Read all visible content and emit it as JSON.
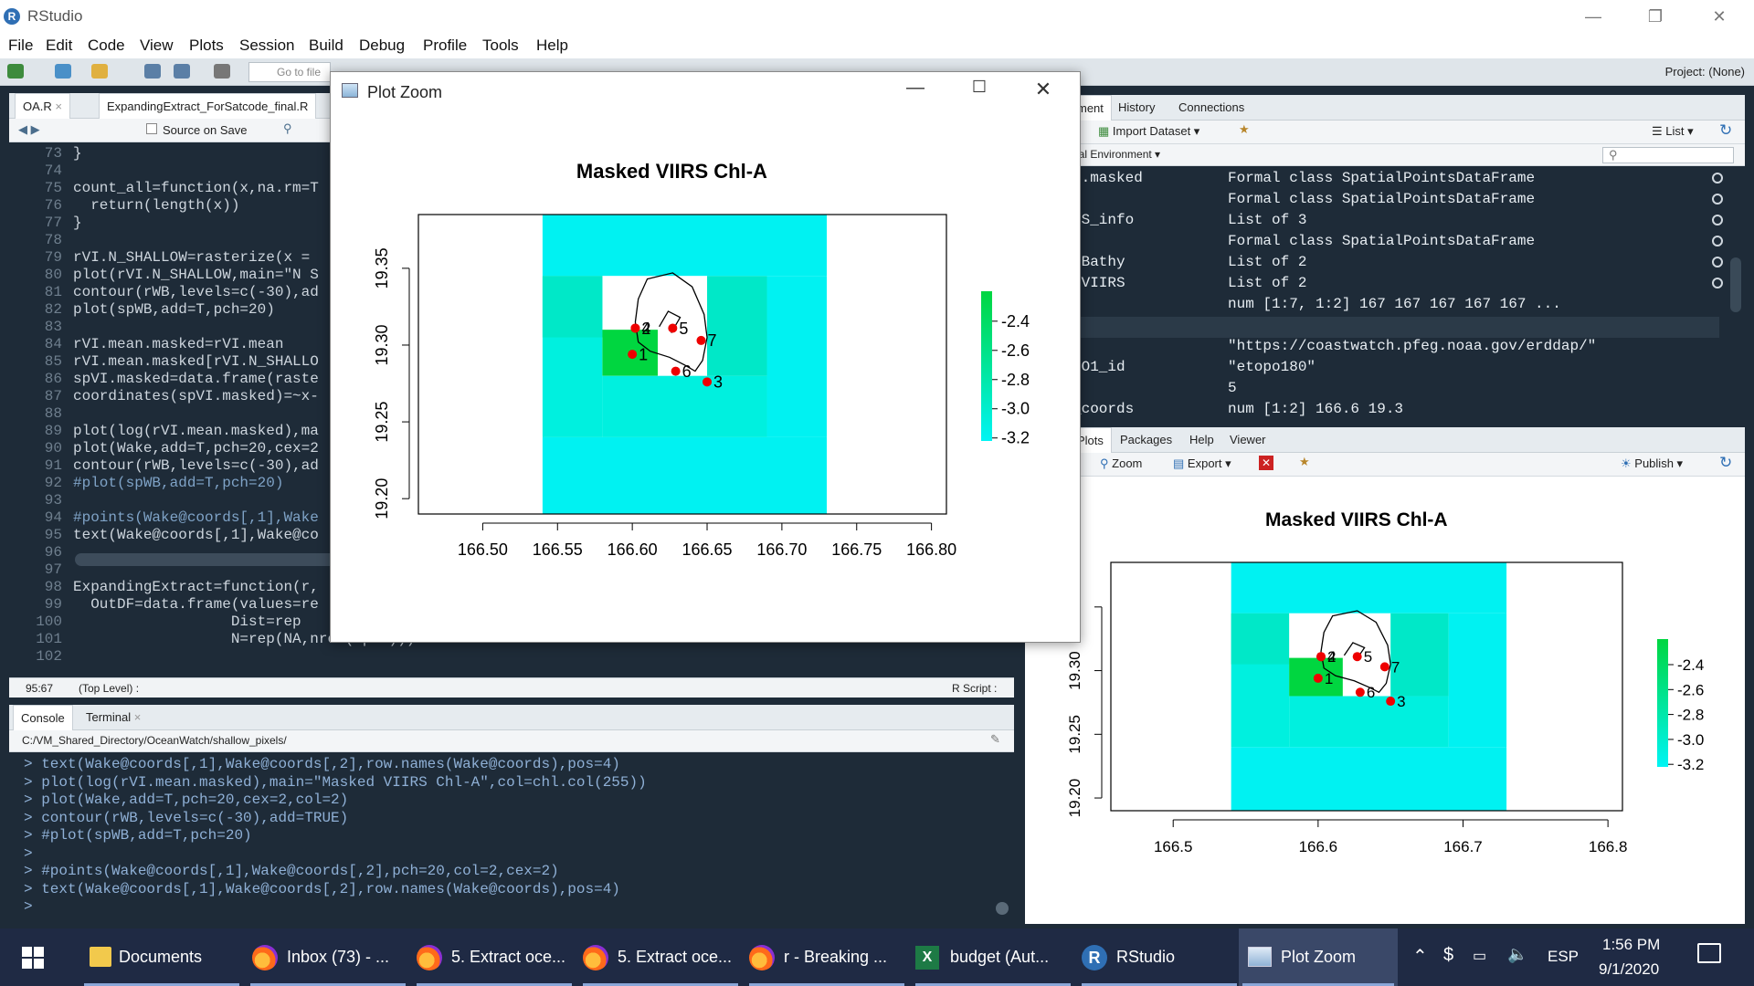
{
  "app": {
    "title": "RStudio"
  },
  "menu": [
    "File",
    "Edit",
    "Code",
    "View",
    "Plots",
    "Session",
    "Build",
    "Debug",
    "Profile",
    "Tools",
    "Help"
  ],
  "toolbar": {
    "goto_placeholder": "Go to file",
    "project": "Project: (None)"
  },
  "editor": {
    "tabs": [
      {
        "label": "OA.R"
      },
      {
        "label": "ExpandingExtract_ForSatcode_final.R"
      }
    ],
    "source_on_save": "Source on Save",
    "lines": [
      {
        "n": "73",
        "t": "}"
      },
      {
        "n": "74",
        "t": ""
      },
      {
        "n": "75",
        "t": "count_all=function(x,na.rm=T"
      },
      {
        "n": "76",
        "t": "  return(length(x))"
      },
      {
        "n": "77",
        "t": "}"
      },
      {
        "n": "78",
        "t": ""
      },
      {
        "n": "79",
        "t": "rVI.N_SHALLOW=rasterize(x = "
      },
      {
        "n": "80",
        "t": "plot(rVI.N_SHALLOW,main=\"N S"
      },
      {
        "n": "81",
        "t": "contour(rWB,levels=c(-30),ad"
      },
      {
        "n": "82",
        "t": "plot(spWB,add=T,pch=20)"
      },
      {
        "n": "83",
        "t": ""
      },
      {
        "n": "84",
        "t": "rVI.mean.masked=rVI.mean"
      },
      {
        "n": "85",
        "t": "rVI.mean.masked[rVI.N_SHALLO"
      },
      {
        "n": "86",
        "t": "spVI.masked=data.frame(raste"
      },
      {
        "n": "87",
        "t": "coordinates(spVI.masked)=~x-"
      },
      {
        "n": "88",
        "t": ""
      },
      {
        "n": "89",
        "t": "plot(log(rVI.mean.masked),ma"
      },
      {
        "n": "90",
        "t": "plot(Wake,add=T,pch=20,cex=2"
      },
      {
        "n": "91",
        "t": "contour(rWB,levels=c(-30),ad"
      },
      {
        "n": "92",
        "t": "#plot(spWB,add=T,pch=20)"
      },
      {
        "n": "93",
        "t": ""
      },
      {
        "n": "94",
        "t": "#points(Wake@coords[,1],Wake"
      },
      {
        "n": "95",
        "t": "text(Wake@coords[,1],Wake@co"
      },
      {
        "n": "96",
        "t": ""
      },
      {
        "n": "97",
        "t": ""
      },
      {
        "n": "98",
        "t": "ExpandingExtract=function(r,"
      },
      {
        "n": "99",
        "t": "  OutDF=data.frame(values=re"
      },
      {
        "n": "100",
        "t": "                  Dist=rep"
      },
      {
        "n": "101",
        "t": "                  N=rep(NA,nrow(spDF)))"
      },
      {
        "n": "102",
        "t": ""
      }
    ],
    "status_pos": "95:67",
    "status_scope": "(Top Level) :",
    "status_type": "R Script :"
  },
  "console": {
    "tabs": [
      {
        "label": "Console"
      },
      {
        "label": "Terminal"
      }
    ],
    "path": "C:/VM_Shared_Directory/OceanWatch/shallow_pixels/",
    "lines": [
      "> text(Wake@coords[,1],Wake@coords[,2],row.names(Wake@coords),pos=4)",
      "> plot(log(rVI.mean.masked),main=\"Masked VIIRS Chl-A\",col=chl.col(255))",
      "> plot(Wake,add=T,pch=20,cex=2,col=2)",
      "> contour(rWB,levels=c(-30),add=TRUE)",
      "> #plot(spWB,add=T,pch=20)",
      ">",
      "> #points(Wake@coords[,1],Wake@coords[,2],pch=20,col=2,cex=2)",
      "> text(Wake@coords[,1],Wake@coords[,2],row.names(Wake@coords),pos=4)",
      "> "
    ]
  },
  "env": {
    "tabs": [
      {
        "label": "ment"
      },
      {
        "label": "History"
      },
      {
        "label": "Connections"
      }
    ],
    "import": "Import Dataset",
    "view": "List",
    "scope": "bal Environment",
    "rows": [
      {
        "n": "I.masked",
        "v": "Formal class SpatialPointsDataFrame"
      },
      {
        "n": "B",
        "v": "Formal class SpatialPointsDataFrame"
      },
      {
        "n": "RS_info",
        "v": "List of 3"
      },
      {
        "n": "e",
        "v": "Formal class SpatialPointsDataFrame"
      },
      {
        "n": "eBathy",
        "v": "List of 2"
      },
      {
        "n": "eVIIRS",
        "v": "List of 2"
      },
      {
        "n": "",
        "v": "num [1:7, 1:2] 167 167 167 167 167 ..."
      }
    ],
    "section": "s",
    "values": [
      {
        "n": "u",
        "v": "\"https://coastwatch.pfeg.noaa.gov/erddap/\""
      },
      {
        "n": "PO1_id",
        "v": "\"etopo180\""
      },
      {
        "n": "",
        "v": "5"
      },
      {
        "n": "_coords",
        "v": "num [1:2] 166.6 19.3"
      }
    ]
  },
  "files": {
    "tabs": [
      {
        "label": "Plots"
      },
      {
        "label": "Packages"
      },
      {
        "label": "Help"
      },
      {
        "label": "Viewer"
      }
    ],
    "zoom": "Zoom",
    "export": "Export",
    "publish": "Publish"
  },
  "zoom_window": {
    "title": "Plot Zoom"
  },
  "chart_data": [
    {
      "type": "heatmap",
      "title": "Masked VIIRS Chl-A",
      "xticks": [
        "166.50",
        "166.55",
        "166.60",
        "166.65",
        "166.70",
        "166.75",
        "166.80"
      ],
      "yticks": [
        "19.20",
        "19.25",
        "19.30",
        "19.35"
      ],
      "legend": [
        "-2.4",
        "-2.6",
        "-2.8",
        "-3.0",
        "-3.2"
      ],
      "points": [
        {
          "label": "1",
          "x": 166.6,
          "y": 19.294
        },
        {
          "label": "2",
          "x": 166.602,
          "y": 19.311
        },
        {
          "label": "4",
          "x": 166.602,
          "y": 19.311
        },
        {
          "label": "5",
          "x": 166.627,
          "y": 19.311
        },
        {
          "label": "6",
          "x": 166.629,
          "y": 19.283
        },
        {
          "label": "7",
          "x": 166.646,
          "y": 19.303
        },
        {
          "label": "3",
          "x": 166.65,
          "y": 19.276
        }
      ]
    },
    {
      "type": "heatmap",
      "title": "Masked VIIRS Chl-A",
      "xticks": [
        "166.5",
        "166.6",
        "166.7",
        "166.8"
      ],
      "yticks": [
        "19.20",
        "19.25",
        "19.30",
        "19.35"
      ],
      "legend": [
        "-2.4",
        "-2.6",
        "-2.8",
        "-3.0",
        "-3.2"
      ]
    }
  ],
  "taskbar": {
    "items": [
      {
        "label": "Documents"
      },
      {
        "label": "Inbox (73) - ..."
      },
      {
        "label": "5. Extract oce..."
      },
      {
        "label": "5. Extract oce..."
      },
      {
        "label": "r - Breaking ..."
      },
      {
        "label": "budget (Aut..."
      },
      {
        "label": "RStudio"
      },
      {
        "label": "Plot Zoom"
      }
    ],
    "lang": "ESP",
    "time": "1:56 PM",
    "date": "9/1/2020"
  }
}
